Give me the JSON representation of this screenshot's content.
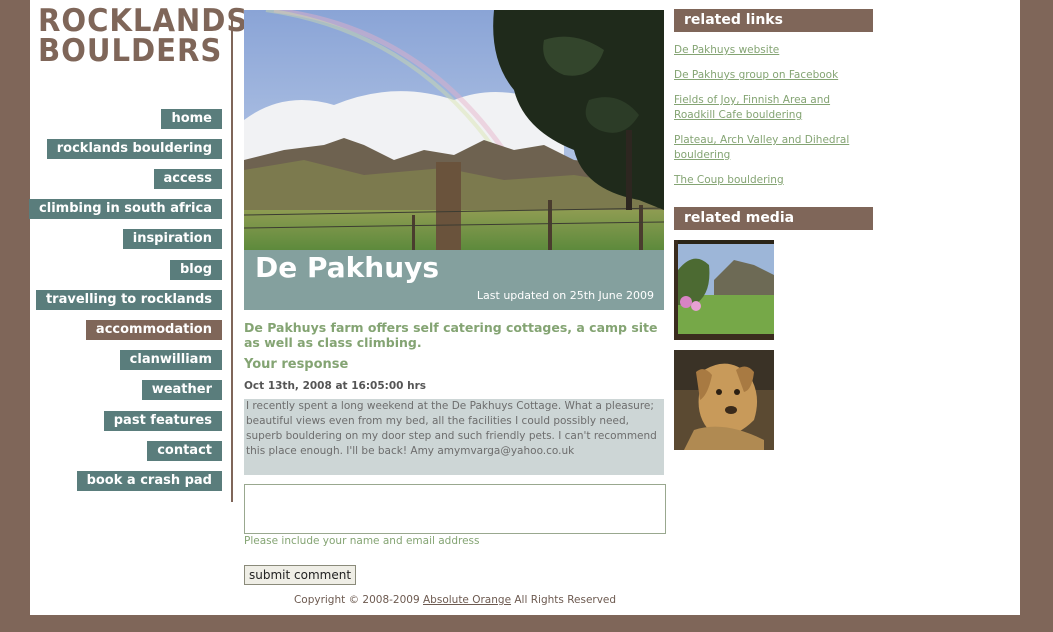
{
  "logo": {
    "line1": "ROCKLANDS",
    "line2": "BOULDERS"
  },
  "nav": [
    {
      "label": "home",
      "active": false
    },
    {
      "label": "rocklands bouldering",
      "active": false
    },
    {
      "label": "access",
      "active": false
    },
    {
      "label": "climbing in south africa",
      "active": false
    },
    {
      "label": "inspiration",
      "active": false
    },
    {
      "label": "blog",
      "active": false
    },
    {
      "label": "travelling to rocklands",
      "active": false
    },
    {
      "label": "accommodation",
      "active": true
    },
    {
      "label": "clanwilliam",
      "active": false
    },
    {
      "label": "weather",
      "active": false
    },
    {
      "label": "past features",
      "active": false
    },
    {
      "label": "contact",
      "active": false
    },
    {
      "label": "book a crash pad",
      "active": false
    }
  ],
  "main": {
    "title": "De Pakhuys",
    "last_updated": "Last updated on 25th June 2009",
    "intro": "De Pakhuys farm offers self catering cottages, a camp site as well as class climbing.",
    "response_heading": "Your response",
    "comment": {
      "date": "Oct 13th, 2008 at 16:05:00 hrs",
      "text": "I recently spent a long weekend at the De Pakhuys Cottage. What a pleasure; beautiful views even from my bed, all the facilities I could possibly need, superb bouldering on my door step and such friendly pets. I can't recommend this place enough. I'll be back! Amy amymvarga@yahoo.co.uk"
    },
    "input_hint": "Please include your name and email address",
    "submit_label": "submit comment"
  },
  "footer": {
    "copyright": "Copyright © 2008-2009",
    "company": "Absolute Orange",
    "rights": "All Rights Reserved"
  },
  "sidebar": {
    "related_links_heading": "related links",
    "links": [
      "De Pakhuys website",
      "De Pakhuys group on Facebook",
      "Fields of Joy, Finnish Area and Roadkill Cafe bouldering",
      "Plateau, Arch Valley and Dihedral bouldering",
      "The Coup bouldering"
    ],
    "related_media_heading": "related media"
  },
  "colors": {
    "brown": "#7f6659",
    "nav_teal": "#5a7d7c",
    "band": "#84a09e",
    "green_text": "#84a473"
  }
}
